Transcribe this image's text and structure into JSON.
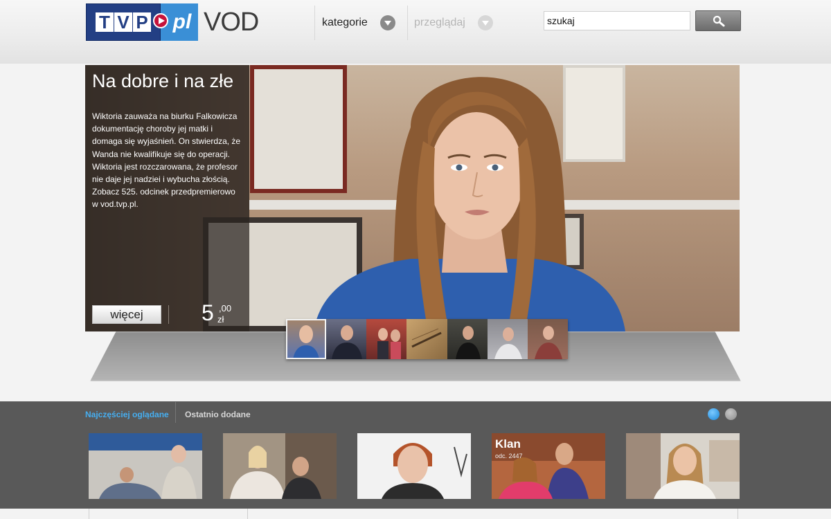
{
  "header": {
    "logo": {
      "tvp": "TVP",
      "pl": "pl",
      "vod": "VOD"
    },
    "nav": [
      {
        "label": "kategorie",
        "disabled": false
      },
      {
        "label": "przeglądaj",
        "disabled": true
      }
    ],
    "search": {
      "value": "szukaj"
    }
  },
  "hero": {
    "title": "Na dobre i na złe",
    "description": "Wiktoria zauważa na biurku Falkowicza dokumentację choroby jej matki i domaga się wyjaśnień. On stwierdza, że Wanda nie kwalifikuje się do operacji. Wiktoria jest rozczarowana, że profesor nie daje jej nadziei i wybucha złością. Zobacz 525. odcinek przedpremierowo w vod.tvp.pl.",
    "more_label": "więcej",
    "price": {
      "integer": "5",
      "decimal": ",00",
      "currency": "zł"
    },
    "thumbnail_count": 7,
    "active_thumbnail": 1
  },
  "bottom": {
    "tabs": [
      {
        "label": "Najczęściej oglądane",
        "active": true
      },
      {
        "label": "Ostatnio dodane",
        "active": false
      }
    ],
    "pager": {
      "pages": 2,
      "active": 1
    },
    "cards": [
      {
        "title": "",
        "subtitle": ""
      },
      {
        "title": "",
        "subtitle": ""
      },
      {
        "title": "",
        "subtitle": ""
      },
      {
        "title": "Klan",
        "subtitle": "odc. 2447"
      },
      {
        "title": "",
        "subtitle": ""
      }
    ]
  },
  "colors": {
    "tvp_blue": "#233f84",
    "pl_blue": "#3a8fd6",
    "active_tab": "#46aef0",
    "bottom_bg": "#595959"
  }
}
